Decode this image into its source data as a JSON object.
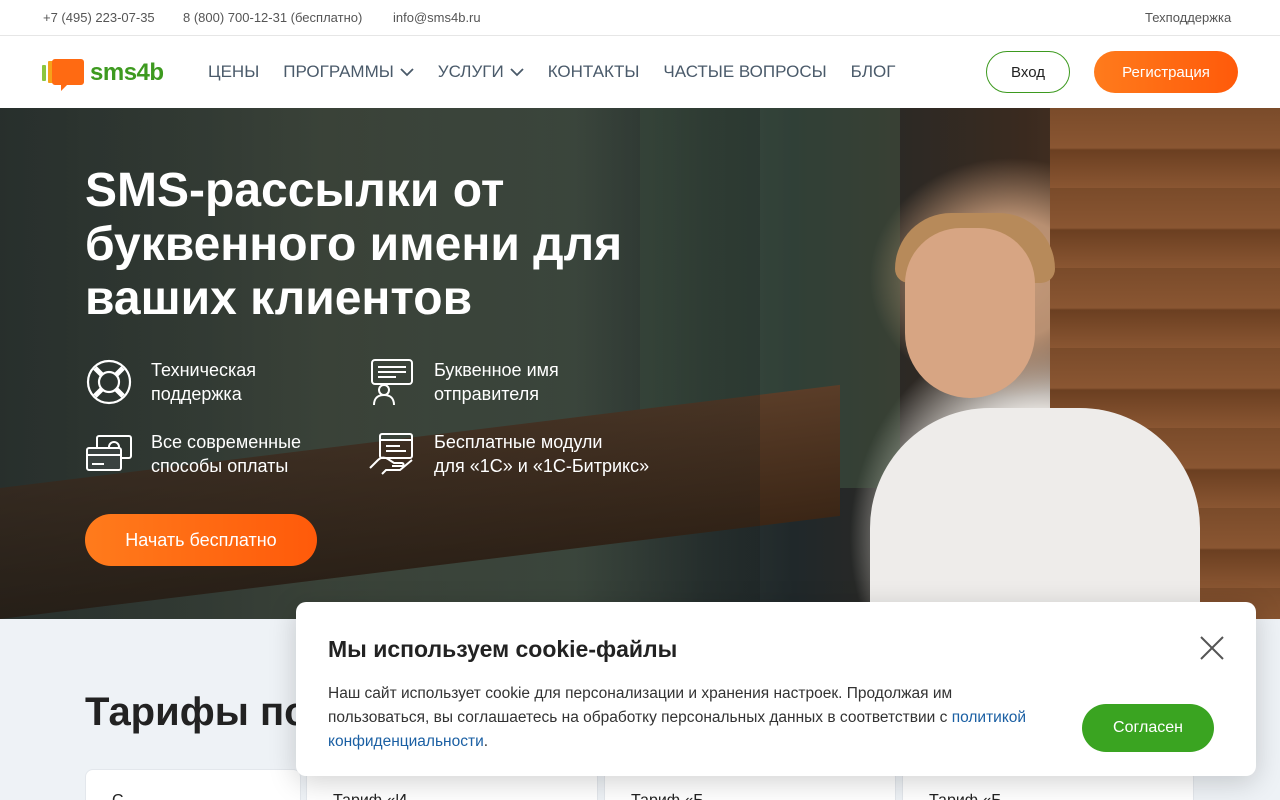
{
  "topbar": {
    "phone1": "+7 (495) 223-07-35",
    "phone2": "8 (800) 700-12-31 (бесплатно)",
    "email": "info@sms4b.ru",
    "support": "Техподдержка"
  },
  "logo": {
    "text": "sms4b",
    "brand_color": "#3d9a1f",
    "icon": "sms4b-logo-icon"
  },
  "nav": {
    "items": [
      {
        "label": "ЦЕНЫ"
      },
      {
        "label": "ПРОГРАММЫ",
        "icon": "chevron-down-icon"
      },
      {
        "label": "УСЛУГИ",
        "icon": "chevron-down-icon"
      },
      {
        "label": "КОНТАКТЫ"
      },
      {
        "label": "ЧАСТЫЕ ВОПРОСЫ"
      },
      {
        "label": "БЛОГ"
      }
    ],
    "login": "Вход",
    "register": "Регистрация"
  },
  "hero": {
    "title": "SMS-рассылки от буквенного имени для ваших клиентов",
    "features": [
      {
        "icon": "lifebuoy-icon",
        "text": "Техническая\nподдержка"
      },
      {
        "icon": "sender-name-icon",
        "text": "Буквенное имя\nотправителя"
      },
      {
        "icon": "payment-cards-icon",
        "text": "Все современные\nспособы оплаты"
      },
      {
        "icon": "modules-hand-icon",
        "text": "Бесплатные модули\nдля «1С» и «1С-Битрикс»"
      }
    ],
    "cta": "Начать бесплатно"
  },
  "tariffs": {
    "title_visible": "Тарифы по",
    "cards": [
      "С",
      "Тариф «И",
      "Тариф «Б",
      "Тариф «Б"
    ]
  },
  "cookie": {
    "title": "Мы используем cookie-файлы",
    "text": "Наш сайт использует cookie для персонализации и хранения настроек. Продолжая им пользоваться, вы соглашаетесь на обработку персональных данных в соответствии с ",
    "link": "политикой конфиденциальности",
    "text_end": ".",
    "accept": "Согласен",
    "accent": "#3aa421"
  },
  "colors": {
    "orange": "#ff6a12",
    "green": "#3d9a1f",
    "link": "#1a5fa3"
  }
}
